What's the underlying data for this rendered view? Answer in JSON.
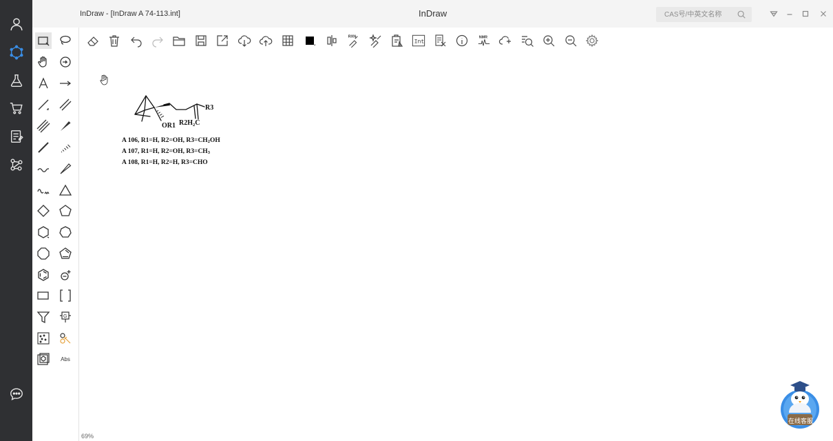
{
  "window": {
    "title": "InDraw - [InDraw A 74-113.int]",
    "app_name": "InDraw"
  },
  "search": {
    "placeholder": "CAS号/中英文名称"
  },
  "left_nav": [
    {
      "icon": "user-icon"
    },
    {
      "icon": "molecule-icon"
    },
    {
      "icon": "flask-icon"
    },
    {
      "icon": "cart-icon"
    },
    {
      "icon": "note-icon"
    },
    {
      "icon": "network-icon"
    },
    {
      "icon": "chat-icon"
    }
  ],
  "toolbar": {
    "rxn_label": "RXN",
    "int_label": "Int",
    "nmr_label": "NMR"
  },
  "palette": {
    "abs_label": "Abs"
  },
  "canvas": {
    "zoom": "69%",
    "molecule_labels": {
      "r3": "R3",
      "or1": "OR1",
      "r2h2c_prefix": "R2H",
      "r2h2c_sub": "2",
      "r2h2c_suffix": "C"
    },
    "legend": [
      {
        "prefix": "A 106, R1=H, R2=OH, R3=CH",
        "sub": "2",
        "suffix": "OH"
      },
      {
        "prefix": "A 107, R1=H, R2=OH, R3=CH",
        "sub": "3",
        "suffix": ""
      },
      {
        "prefix": "A 108, R1=H, R2=H, R3=CHO",
        "sub": "",
        "suffix": ""
      }
    ]
  },
  "chat_widget": {
    "label": "在线客服"
  },
  "colors": {
    "nav_bg": "#2f3033",
    "titlebar_bg": "#f4f4f4",
    "accent_blue": "#3a8ee6"
  }
}
